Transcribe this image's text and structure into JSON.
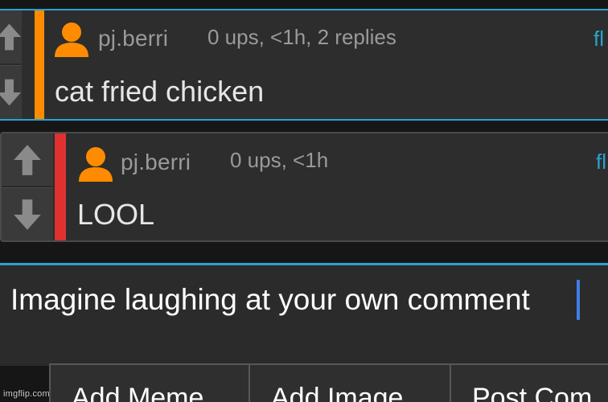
{
  "comments": [
    {
      "username": "pj.berri",
      "meta": "0 ups, <1h, 2 replies",
      "flag": "fl",
      "text": "cat fried chicken",
      "level_color": "#ff8c00"
    },
    {
      "username": "pj.berri",
      "meta": "0 ups, <1h",
      "flag": "fl",
      "text": "LOOL",
      "level_color": "#e03131"
    }
  ],
  "reply": {
    "value": "Imagine laughing at your own comment"
  },
  "buttons": {
    "add_meme": "Add Meme",
    "add_image": "Add Image",
    "post_comment": "Post Com"
  },
  "watermark": "imgflip.com",
  "colors": {
    "accent": "#2aa3cf",
    "avatar": "#ff8c00",
    "caret": "#3f7ee8"
  },
  "icons": {
    "upvote": "arrow-up-icon",
    "downvote": "arrow-down-icon",
    "avatar": "user-avatar-icon"
  }
}
